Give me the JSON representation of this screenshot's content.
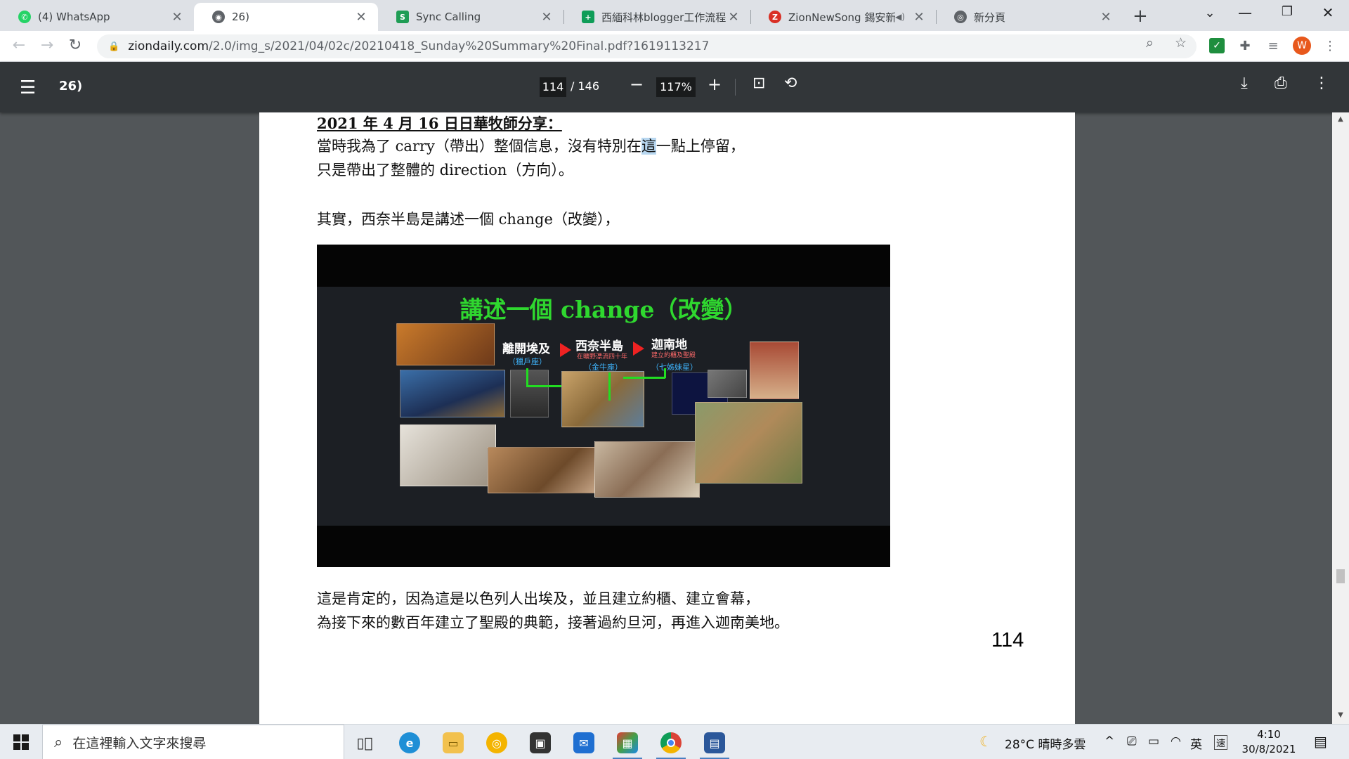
{
  "browser": {
    "tabs": [
      {
        "title": "(4) WhatsApp",
        "icon": "whatsapp-icon",
        "color": "#25d366",
        "active": false
      },
      {
        "title": "26)",
        "icon": "globe-icon",
        "color": "#5f6368",
        "active": true
      },
      {
        "title": "Sync Calling",
        "icon": "sync-calling-icon",
        "color": "#1f9d55",
        "active": false
      },
      {
        "title": "西緬科林blogger工作流程",
        "icon": "sheets-icon",
        "color": "#0f9d58",
        "active": false
      },
      {
        "title": "ZionNewSong 錫安新",
        "icon": "zion-icon",
        "color": "#d93025",
        "active": false
      },
      {
        "title": "新分頁",
        "icon": "chrome-icon",
        "color": "#5f6368",
        "active": false
      }
    ],
    "url_host": "ziondaily.com",
    "url_path": "/2.0/img_s/2021/04/02c/20210418_Sunday%20Summary%20Final.pdf?1619113217",
    "profile_initial": "W",
    "profile_color": "#e8581c"
  },
  "pdf": {
    "title": "26)",
    "current_page": "114",
    "total_pages": "/ 146",
    "zoom": "117%",
    "heading": "2021 年 4 月 16 日日華牧師分享：",
    "line1_pre": "當時我為了 carry（帶出）整個信息，沒有特別在",
    "line1_hl": "這",
    "line1_post": "一點上停留，",
    "line2": "只是帶出了整體的 direction（方向）。",
    "line3": "其實，西奈半島是講述一個 change（改變），",
    "line4": "這是肯定的，因為這是以色列人出埃及，並且建立約櫃、建立會幕，",
    "line5": "為接下來的數百年建立了聖殿的典範，接著過約旦河，再進入迦南美地。",
    "page_number": "114"
  },
  "slide": {
    "title": "講述一個 change（改變）",
    "stage1": "離開埃及",
    "stage1_tag": "（獵戶座）",
    "stage2": "西奈半島",
    "stage2_sub": "在曠野漂流四十年",
    "stage2_tag": "（金牛座）",
    "stage3": "迦南地",
    "stage3_sub": "建立約櫃及聖殿",
    "stage3_tag": "（七姊妹星）"
  },
  "taskbar": {
    "search_placeholder": "在這裡輸入文字來搜尋",
    "weather": "28°C  晴時多雲",
    "ime": "英",
    "ime2": "速",
    "time": "4:10",
    "date": "30/8/2021"
  }
}
